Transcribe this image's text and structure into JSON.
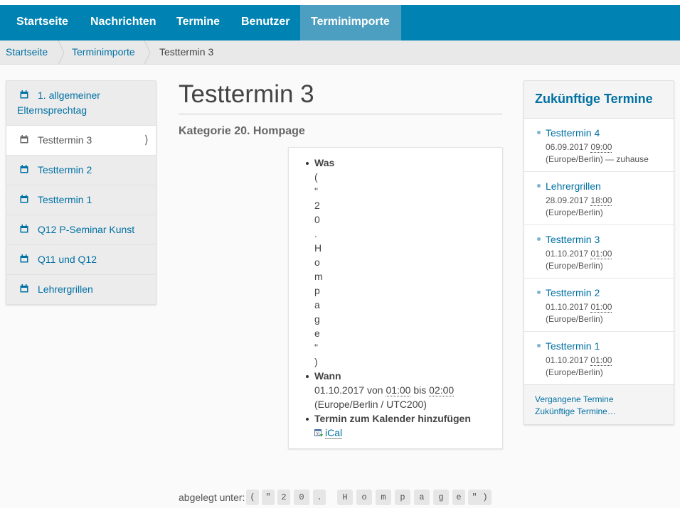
{
  "nav": {
    "items": [
      {
        "label": "Startseite",
        "active": false
      },
      {
        "label": "Nachrichten",
        "active": false
      },
      {
        "label": "Termine",
        "active": false
      },
      {
        "label": "Benutzer",
        "active": false
      },
      {
        "label": "Terminimporte",
        "active": true
      }
    ]
  },
  "breadcrumb": {
    "items": [
      "Startseite",
      "Terminimporte",
      "Testtermin 3"
    ]
  },
  "sidebar": {
    "items": [
      {
        "label": "1. allgemeiner Elternsprechtag",
        "icon": "calendar-icon",
        "active": false
      },
      {
        "label": "Testtermin 3",
        "icon": "calendar-icon",
        "active": true
      },
      {
        "label": "Testtermin 2",
        "icon": "calendar-icon",
        "active": false
      },
      {
        "label": "Testtermin 1",
        "icon": "calendar-icon",
        "active": false
      },
      {
        "label": "Q12 P-Seminar Kunst",
        "icon": "calendar-icon",
        "active": false
      },
      {
        "label": "Q11 und Q12",
        "icon": "calendar-icon",
        "active": false
      },
      {
        "label": "Lehrergrillen",
        "icon": "calendar-icon",
        "active": false
      }
    ],
    "active_chevron": "⟩"
  },
  "main": {
    "title": "Testtermin 3",
    "category": "Kategorie 20. Hompage",
    "info": {
      "was_label": "Was",
      "was_chars": [
        "(",
        "\"",
        "2",
        "0",
        ".",
        "H",
        "o",
        "m",
        "p",
        "a",
        "g",
        "e",
        "\"",
        ")"
      ],
      "wann_label": "Wann",
      "wann_date": "01.10.2017",
      "wann_von": "von",
      "wann_start": "01:00",
      "wann_bis": "bis",
      "wann_end": "02:00",
      "wann_tz": "(Europe/Berlin / UTC200)",
      "calendar_label": "Termin zum Kalender hinzufügen",
      "ical_label": "iCal"
    },
    "tags_label": "abgelegt unter:",
    "tags": [
      "(",
      "\"",
      "2",
      "0",
      ".",
      "H",
      "o",
      "m",
      "p",
      "a",
      "g",
      "e",
      "\"",
      ")"
    ]
  },
  "widget": {
    "title": "Zukünftige Termine",
    "events": [
      {
        "title": "Testtermin 4",
        "date": "06.09.2017",
        "time": "09:00",
        "tz": "(Europe/Berlin) — zuhause"
      },
      {
        "title": "Lehrergrillen",
        "date": "28.09.2017",
        "time": "18:00",
        "tz": "(Europe/Berlin)"
      },
      {
        "title": "Testtermin 3",
        "date": "01.10.2017",
        "time": "01:00",
        "tz": "(Europe/Berlin)"
      },
      {
        "title": "Testtermin 2",
        "date": "01.10.2017",
        "time": "01:00",
        "tz": "(Europe/Berlin)"
      },
      {
        "title": "Testtermin 1",
        "date": "01.10.2017",
        "time": "01:00",
        "tz": "(Europe/Berlin)"
      }
    ],
    "past_link": "Vergangene Termine",
    "future_link": "Zukünftige Termine…"
  },
  "colors": {
    "nav_bg": "#0083b3",
    "nav_active": "#4d9fc1",
    "link": "#0070a3"
  }
}
